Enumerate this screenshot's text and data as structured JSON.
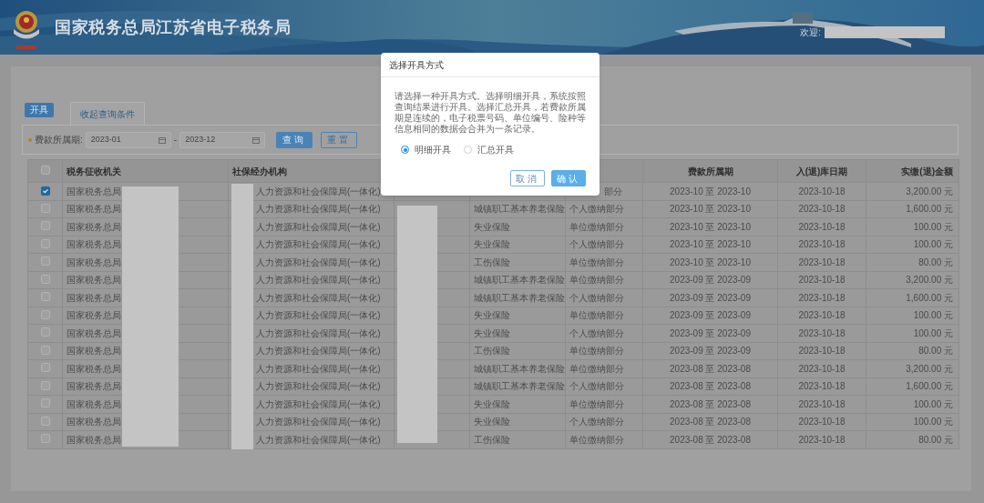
{
  "header": {
    "title": "国家税务总局江苏省电子税务局",
    "welcome": "欢迎:"
  },
  "tabs": [
    {
      "label": "开具",
      "kind": "button"
    },
    {
      "label": "收起查询条件",
      "kind": "tab"
    }
  ],
  "filter": {
    "label": "费款所属期:",
    "required": true,
    "start": "2023-01",
    "separator": "-",
    "end": "2023-12",
    "buttons": [
      {
        "label": "查询",
        "kind": "primary"
      },
      {
        "label": "重置",
        "kind": "outline"
      }
    ]
  },
  "table": {
    "select_all": {
      "checked": false
    },
    "columns": {
      "tax_authority": "税务征收机关",
      "social_security_agency": "社保经办机构",
      "fee_period": "费款所属期",
      "storage_date": "入(退)库日期",
      "amount": "实缴(退)金额"
    },
    "rows": [
      {
        "checked": true,
        "tax_authority": "国家税务总局",
        "social_security_agency": "人力资源和社会保障局(一体化)",
        "column_6": "部分",
        "fee_period": "2023-10 至 2023-10",
        "storage_date": "2023-10-18",
        "amount": "3,200.00 元"
      },
      {
        "checked": false,
        "tax_authority": "国家税务总局",
        "social_security_agency": "人力资源和社会保障局(一体化)",
        "column_5": "城镇职工基本养老保险",
        "column_6": "个人缴纳部分",
        "fee_period": "2023-10 至 2023-10",
        "storage_date": "2023-10-18",
        "amount": "1,600.00 元"
      },
      {
        "checked": false,
        "tax_authority": "国家税务总局",
        "social_security_agency": "人力资源和社会保障局(一体化)",
        "column_5": "失业保险",
        "column_6": "单位缴纳部分",
        "fee_period": "2023-10 至 2023-10",
        "storage_date": "2023-10-18",
        "amount": "100.00 元"
      },
      {
        "checked": false,
        "tax_authority": "国家税务总局",
        "social_security_agency": "人力资源和社会保障局(一体化)",
        "column_5": "失业保险",
        "column_6": "个人缴纳部分",
        "fee_period": "2023-10 至 2023-10",
        "storage_date": "2023-10-18",
        "amount": "100.00 元"
      },
      {
        "checked": false,
        "tax_authority": "国家税务总局",
        "social_security_agency": "人力资源和社会保障局(一体化)",
        "column_5": "工伤保险",
        "column_6": "单位缴纳部分",
        "fee_period": "2023-10 至 2023-10",
        "storage_date": "2023-10-18",
        "amount": "80.00 元"
      },
      {
        "checked": false,
        "tax_authority": "国家税务总局",
        "social_security_agency": "人力资源和社会保障局(一体化)",
        "column_5": "城镇职工基本养老保险",
        "column_6": "单位缴纳部分",
        "fee_period": "2023-09 至 2023-09",
        "storage_date": "2023-10-18",
        "amount": "3,200.00 元"
      },
      {
        "checked": false,
        "tax_authority": "国家税务总局",
        "social_security_agency": "人力资源和社会保障局(一体化)",
        "column_5": "城镇职工基本养老保险",
        "column_6": "个人缴纳部分",
        "fee_period": "2023-09 至 2023-09",
        "storage_date": "2023-10-18",
        "amount": "1,600.00 元"
      },
      {
        "checked": false,
        "tax_authority": "国家税务总局",
        "social_security_agency": "人力资源和社会保障局(一体化)",
        "column_5": "失业保险",
        "column_6": "单位缴纳部分",
        "fee_period": "2023-09 至 2023-09",
        "storage_date": "2023-10-18",
        "amount": "100.00 元"
      },
      {
        "checked": false,
        "tax_authority": "国家税务总局",
        "social_security_agency": "人力资源和社会保障局(一体化)",
        "column_5": "失业保险",
        "column_6": "个人缴纳部分",
        "fee_period": "2023-09 至 2023-09",
        "storage_date": "2023-10-18",
        "amount": "100.00 元"
      },
      {
        "checked": false,
        "tax_authority": "国家税务总局",
        "social_security_agency": "人力资源和社会保障局(一体化)",
        "column_5": "工伤保险",
        "column_6": "单位缴纳部分",
        "fee_period": "2023-09 至 2023-09",
        "storage_date": "2023-10-18",
        "amount": "80.00 元"
      },
      {
        "checked": false,
        "tax_authority": "国家税务总局",
        "social_security_agency": "人力资源和社会保障局(一体化)",
        "column_5": "城镇职工基本养老保险",
        "column_6": "单位缴纳部分",
        "fee_period": "2023-08 至 2023-08",
        "storage_date": "2023-10-18",
        "amount": "3,200.00 元"
      },
      {
        "checked": false,
        "tax_authority": "国家税务总局",
        "social_security_agency": "人力资源和社会保障局(一体化)",
        "column_5": "城镇职工基本养老保险",
        "column_6": "个人缴纳部分",
        "fee_period": "2023-08 至 2023-08",
        "storage_date": "2023-10-18",
        "amount": "1,600.00 元"
      },
      {
        "checked": false,
        "tax_authority": "国家税务总局",
        "social_security_agency": "人力资源和社会保障局(一体化)",
        "column_5": "失业保险",
        "column_6": "单位缴纳部分",
        "fee_period": "2023-08 至 2023-08",
        "storage_date": "2023-10-18",
        "amount": "100.00 元"
      },
      {
        "checked": false,
        "tax_authority": "国家税务总局",
        "social_security_agency": "人力资源和社会保障局(一体化)",
        "column_5": "失业保险",
        "column_6": "个人缴纳部分",
        "fee_period": "2023-08 至 2023-08",
        "storage_date": "2023-10-18",
        "amount": "100.00 元"
      },
      {
        "checked": false,
        "tax_authority": "国家税务总局",
        "social_security_agency": "人力资源和社会保障局(一体化)",
        "column_5": "工伤保险",
        "column_6": "单位缴纳部分",
        "fee_period": "2023-08 至 2023-08",
        "storage_date": "2023-10-18",
        "amount": "80.00 元"
      }
    ]
  },
  "dialog": {
    "title": "选择开具方式",
    "message": "请选择一种开具方式。选择明细开具，系统按照查询结果进行开具。选择汇总开具，若费款所属期是连续的，电子税票号码、单位编号、险种等信息相同的数据会合并为一条记录。",
    "options": [
      {
        "label": "明细开具",
        "selected": true
      },
      {
        "label": "汇总开具",
        "selected": false
      }
    ],
    "buttons": [
      {
        "label": "取消",
        "kind": "outline"
      },
      {
        "label": "确认",
        "kind": "primary"
      }
    ]
  }
}
